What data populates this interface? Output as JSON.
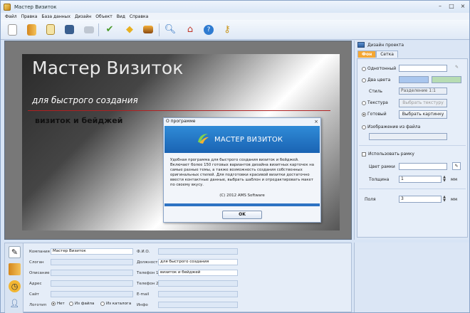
{
  "window": {
    "title": "Мастер Визиток"
  },
  "menu": [
    "Файл",
    "Правка",
    "База данных",
    "Дизайн",
    "Объект",
    "Вид",
    "Справка"
  ],
  "toolbar": [
    "new-icon",
    "open-book-icon",
    "template-icon",
    "save-icon",
    "print-icon",
    "check-icon",
    "shapes-icon",
    "image-icon",
    "zoom-icon",
    "home-icon",
    "help-icon",
    "key-icon"
  ],
  "card": {
    "title": "Мастер Визиток",
    "subtitle": "для быстрого создания",
    "subtitle2": "визиток и бейджей",
    "line_color": "#b02020"
  },
  "dialog": {
    "title": "О программе",
    "close": "×",
    "banner": "МАСТЕР ВИЗИТОК",
    "body": "Удобная программа для быстрого создания визиток и бейджей. Включает более 150 готовых вариантов дизайна визитных карточек на самые разные темы, а также возможность создания собственных оригинальных стилей. Для подготовки красивой визитки достаточно ввести контактные данные, выбрать шаблон и отредактировать макет по своему вкусу.",
    "copyright": "(C) 2012 AMS Software",
    "ok": "OK",
    "accent": "#2e73c3"
  },
  "design_panel": {
    "title": "Дизайн проекта",
    "tabs": [
      "Фон",
      "Сетка"
    ],
    "active_tab": "Фон",
    "solid_label": "Однотонный",
    "two_color_label": "Два цвета",
    "two_color_a": "#a9c6ee",
    "two_color_b": "#b7dcb3",
    "style_label": "Стиль",
    "style_value": "Разделение 1:1",
    "texture_label": "Текстура",
    "texture_button": "Выбрать текстуру",
    "ready_label": "Готовый",
    "picture_button": "Выбрать картинку",
    "image_file_label": "Изображение из файла",
    "use_frame_label": "Использовать рамку",
    "frame_color_label": "Цвет рамки",
    "thickness_label": "Толщина",
    "thickness_value": "1",
    "margins_label": "Поля",
    "margins_value": "3",
    "unit": "мм",
    "selected_option": "Готовый"
  },
  "fields": {
    "company_label": "Компания",
    "company_value": "Мастер Визиток",
    "slogan_label": "Слоган",
    "slogan_value": "",
    "description_label": "Описание",
    "description_value": "",
    "address_label": "Адрес",
    "address_value": "",
    "site_label": "Сайт",
    "site_value": "",
    "logo_label": "Логотип",
    "logo_opt1": "Нет",
    "logo_opt2": "Из файла",
    "logo_opt3": "Из каталога",
    "fio_label": "Ф.И.О.",
    "fio_value": "",
    "position_label": "Должность",
    "position_value": "для быстрого создания",
    "phone1_label": "Телефон 1",
    "phone1_value": "визиток и бейджей",
    "phone2_label": "Телефон 2",
    "phone2_value": "",
    "email_label": "E-mail",
    "email_value": "",
    "info_label": "Инфо",
    "info_value": ""
  },
  "side_tools": [
    "edit-card-icon",
    "catalog-icon",
    "clock-icon",
    "user-icon"
  ]
}
